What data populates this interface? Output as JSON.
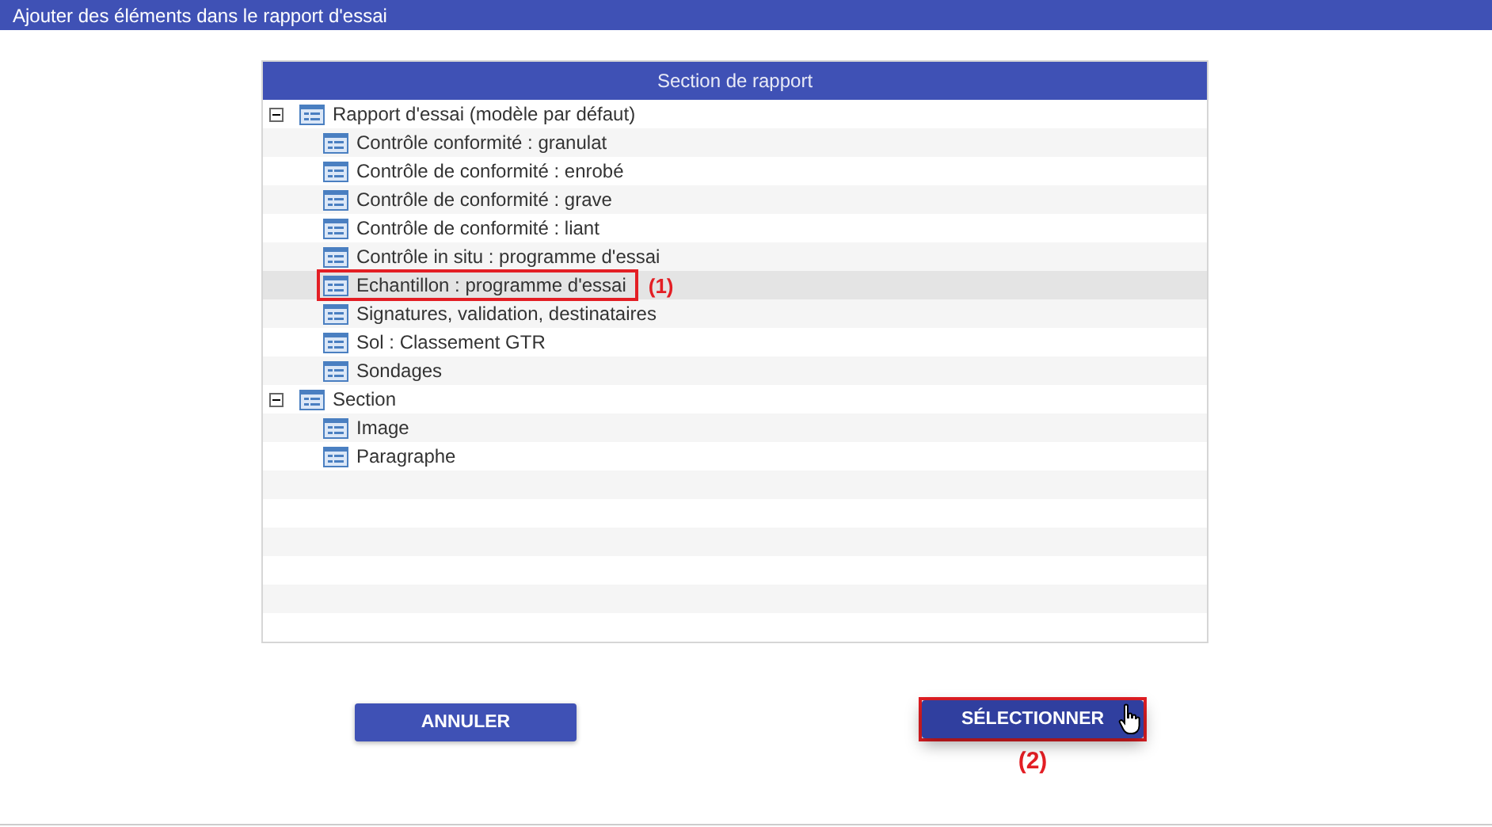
{
  "window": {
    "title": "Ajouter des éléments dans le rapport d'essai"
  },
  "grid": {
    "header": "Section de rapport",
    "tree": [
      {
        "label": "Rapport d'essai (modèle par défaut)",
        "expanded": true,
        "selected": false,
        "children": [
          {
            "label": "Contrôle conformité : granulat",
            "selected": false
          },
          {
            "label": "Contrôle de conformité : enrobé",
            "selected": false
          },
          {
            "label": "Contrôle de conformité : grave",
            "selected": false
          },
          {
            "label": "Contrôle de conformité : liant",
            "selected": false
          },
          {
            "label": "Contrôle in situ : programme d'essai",
            "selected": false
          },
          {
            "label": "Echantillon : programme d'essai",
            "selected": true,
            "callout": "(1)"
          },
          {
            "label": "Signatures, validation, destinataires",
            "selected": false
          },
          {
            "label": "Sol : Classement GTR",
            "selected": false
          },
          {
            "label": "Sondages",
            "selected": false
          }
        ]
      },
      {
        "label": "Section",
        "expanded": true,
        "selected": false,
        "children": [
          {
            "label": "Image",
            "selected": false
          },
          {
            "label": "Paragraphe",
            "selected": false
          }
        ]
      }
    ]
  },
  "buttons": [
    {
      "label": "ANNULER",
      "hovered": false
    },
    {
      "label": "SÉLECTIONNER",
      "hovered": true,
      "callout": "(2)"
    }
  ]
}
